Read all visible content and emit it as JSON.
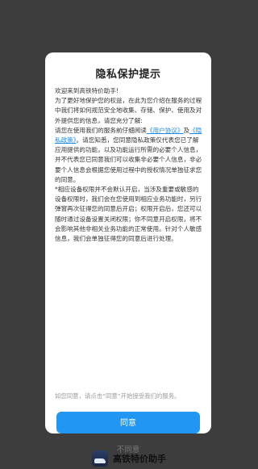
{
  "dialog": {
    "title": "隐私保护提示",
    "greeting": "欢迎来到高铁特价助手!",
    "para1": "为了更好地保护您的权益，在此为您介绍在服务的过程中我们将如何规范安全地收集、存储、保护、使用及对外提供您的信息，请您充分了解:",
    "para2_prefix": "请您在使用我们的服务前仔细阅读",
    "user_agreement_link": "《用户协议》",
    "and_text": "及",
    "privacy_policy_link": "《隐私政策》",
    "para2_suffix": "。请您知悉，您同意隐私政策仅代表您已了解应用提供的功能，以及功能运行所需的必要个人信息，并不代表您已同意我们可以收集非必要个人信息，非必要个人信息会根据您使用过程中的授权情况单独征求您的同意。",
    "para3": "*相应设备权限并不会默认开启，当涉及重要或敏感的设备权限时，我们会在您使用到相应业务功能时，另行弹窗再次征得您的同意后开启；权限开启后，您还可以随时通过设备设置关闭权限；你不同意开启权限，将不会影响其他非相关业务功能的正常使用。针对个人敏感信息，我们会单独征得您的同意后进行处理。",
    "note": "如您同意，请点击“同意”开始接受我们的服务。",
    "agree_label": "同意",
    "disagree_label": "不同意"
  },
  "footer": {
    "app_name": "高铁特价助手",
    "icon": "train-app-icon"
  },
  "colors": {
    "accent": "#2196f3",
    "link": "#1e88e5",
    "overlay": "#3d3d3d"
  }
}
